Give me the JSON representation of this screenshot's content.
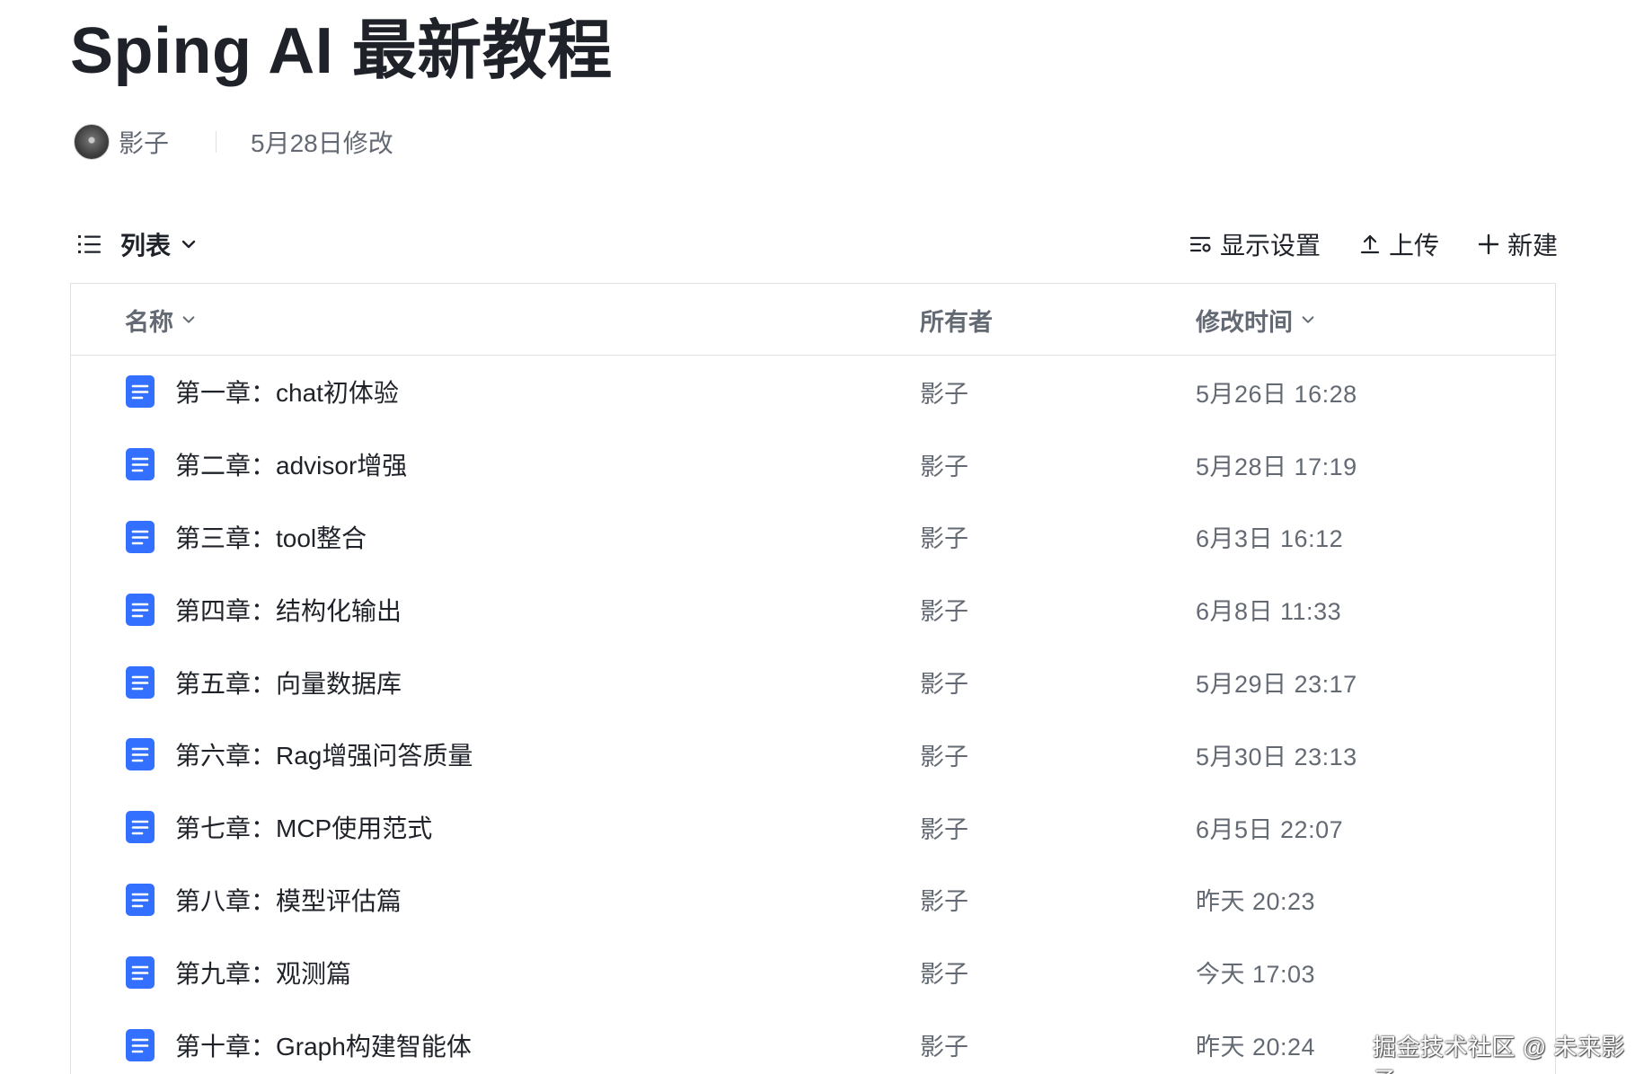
{
  "document": {
    "title": "Sping AI 最新教程",
    "author": "影子",
    "modified": "5月28日修改"
  },
  "toolbar": {
    "view_label": "列表",
    "display_settings_label": "显示设置",
    "upload_label": "上传",
    "new_label": "新建"
  },
  "table": {
    "headers": {
      "name": "名称",
      "owner": "所有者",
      "modified_time": "修改时间"
    },
    "rows": [
      {
        "name": "第一章：chat初体验",
        "owner": "影子",
        "time": "5月26日 16:28"
      },
      {
        "name": "第二章：advisor增强",
        "owner": "影子",
        "time": "5月28日 17:19"
      },
      {
        "name": "第三章：tool整合",
        "owner": "影子",
        "time": "6月3日 16:12"
      },
      {
        "name": "第四章：结构化输出",
        "owner": "影子",
        "time": "6月8日 11:33"
      },
      {
        "name": "第五章：向量数据库",
        "owner": "影子",
        "time": "5月29日 23:17"
      },
      {
        "name": "第六章：Rag增强问答质量",
        "owner": "影子",
        "time": "5月30日 23:13"
      },
      {
        "name": "第七章：MCP使用范式",
        "owner": "影子",
        "time": "6月5日 22:07"
      },
      {
        "name": "第八章：模型评估篇",
        "owner": "影子",
        "time": "昨天 20:23"
      },
      {
        "name": "第九章：观测篇",
        "owner": "影子",
        "time": "今天 17:03"
      },
      {
        "name": "第十章：Graph构建智能体",
        "owner": "影子",
        "time": "昨天 20:24"
      }
    ]
  },
  "watermark": "掘金技术社区 @ 未来影子",
  "colors": {
    "doc_icon": "#3370ff",
    "text_primary": "#1f2329",
    "text_secondary": "#646a73",
    "border": "#dee0e3"
  }
}
